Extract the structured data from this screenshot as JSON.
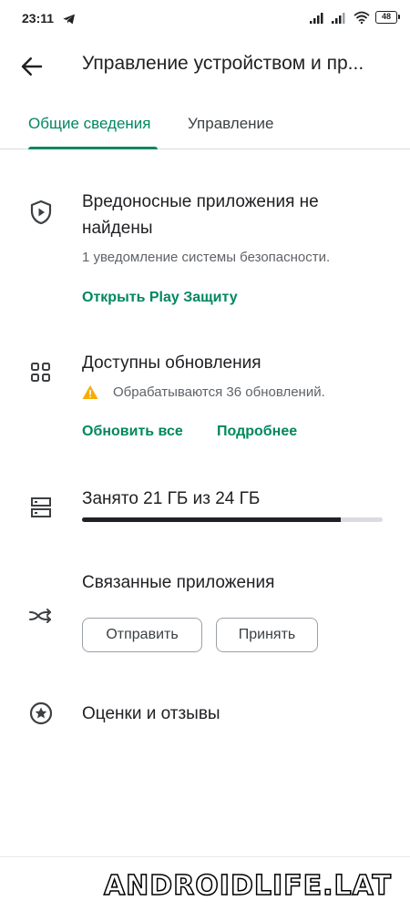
{
  "status_bar": {
    "time": "23:11",
    "battery": "48",
    "icons": [
      "telegram-icon",
      "signal-icon",
      "signal-icon",
      "wifi-icon",
      "battery-icon"
    ]
  },
  "app_bar": {
    "back_icon": "arrow-back-icon",
    "title": "Управление устройством и пр..."
  },
  "tabs": [
    {
      "label": "Общие сведения",
      "active": true
    },
    {
      "label": "Управление",
      "active": false
    }
  ],
  "accent_color": "#01875f",
  "protection": {
    "icon": "shield-play-icon",
    "title_line1": "Вредоносные приложения не",
    "title_line2": "найдены",
    "subtitle": "1 уведомление системы безопасности.",
    "link": "Открыть Play Защиту"
  },
  "updates": {
    "icon": "apps-grid-icon",
    "title": "Доступны обновления",
    "warning_icon": "warning-icon",
    "status": "Обрабатываются 36 обновлений.",
    "update_all": "Обновить все",
    "details": "Подробнее"
  },
  "storage": {
    "icon": "storage-icon",
    "label": "Занято 21 ГБ из 24 ГБ",
    "used_fraction": 0.86
  },
  "linked_apps": {
    "icon": "share-sync-icon",
    "title": "Связанные приложения",
    "send": "Отправить",
    "receive": "Принять"
  },
  "ratings": {
    "icon": "star-circle-icon",
    "title": "Оценки и отзывы"
  },
  "watermark": "ANDROIDLIFE.LAT"
}
